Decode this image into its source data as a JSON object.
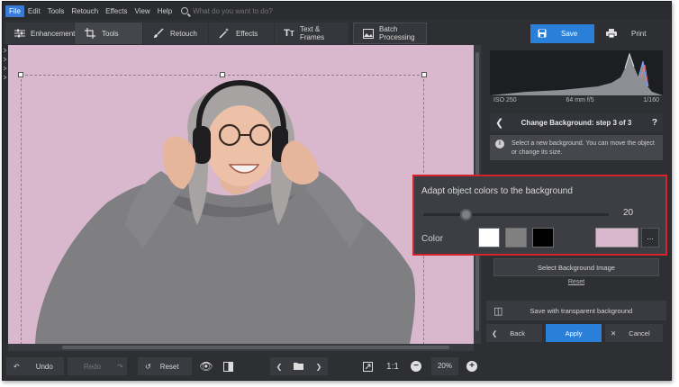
{
  "menu": {
    "items": [
      "File",
      "Edit",
      "Tools",
      "Retouch",
      "Effects",
      "View",
      "Help"
    ],
    "search_placeholder": "What do you want to do?"
  },
  "toolbar": {
    "tabs": [
      {
        "label": "Enhancement",
        "icon": "sliders-icon"
      },
      {
        "label": "Tools",
        "icon": "crop-icon"
      },
      {
        "label": "Retouch",
        "icon": "brush-icon"
      },
      {
        "label": "Effects",
        "icon": "magic-wand-icon"
      },
      {
        "label": "Text & Frames",
        "icon": "text-icon"
      }
    ],
    "active_tab": "Tools",
    "batch_label": "Batch Processing",
    "save_label": "Save",
    "print_label": "Print"
  },
  "histogram": {
    "iso": "ISO 250",
    "lens": "64 mm f/5",
    "shutter": "1/160"
  },
  "panel": {
    "step_title": "Change Background: step 3 of 3",
    "help_glyph": "?",
    "info_text": "Select a new background. You can move the object or change its size.",
    "select_bg_label": "Select Background Image",
    "reset_label": "Reset",
    "save_transparent_label": "Save with transparent background",
    "back_label": "Back",
    "apply_label": "Apply",
    "cancel_label": "Cancel"
  },
  "adapt": {
    "title": "Adapt object colors to the background",
    "slider_value": "20",
    "slider_fraction": 0.2,
    "color_label": "Color",
    "swatches": [
      "#ffffff",
      "#808080",
      "#000000"
    ],
    "selected_color": "#d9b7cd",
    "more_label": "..."
  },
  "bottom": {
    "undo_label": "Undo",
    "redo_label": "Redo",
    "reset_label": "Reset",
    "ratio_label": "1:1",
    "zoom_value": "20%"
  },
  "colors": {
    "accent": "#2a7fd8",
    "highlight": "#d5232e",
    "canvas_bg": "#d9b7cd"
  }
}
